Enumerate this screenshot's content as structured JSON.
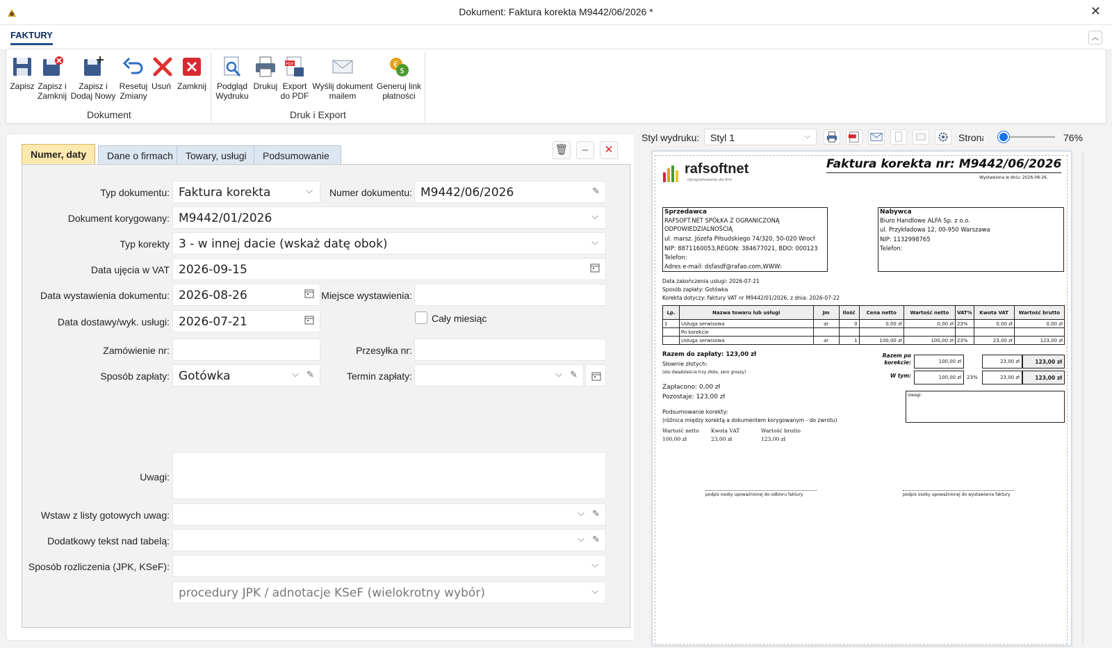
{
  "window": {
    "title": "Dokument: Faktura korekta M9442/06/2026 *"
  },
  "ribbon": {
    "tab": "FAKTURY",
    "buttons": [
      {
        "label": "Zapisz",
        "icon": "save-icon"
      },
      {
        "label": "Zapisz i Zamknij",
        "icon": "save-close-icon"
      },
      {
        "label": "Zapisz i Dodaj Nowy",
        "icon": "save-new-icon"
      },
      {
        "label": "Resetuj Zmiany",
        "icon": "undo-icon"
      },
      {
        "label": "Usuń",
        "icon": "delete-icon"
      },
      {
        "label": "Zamknij",
        "icon": "close-icon"
      },
      {
        "label": "Podgląd Wydruku",
        "icon": "print-preview-icon"
      },
      {
        "label": "Drukuj",
        "icon": "printer-icon"
      },
      {
        "label": "Export do PDF",
        "icon": "pdf-icon"
      },
      {
        "label": "Wyślij dokument mailem",
        "icon": "mail-icon"
      },
      {
        "label": "Generuj link płatności",
        "icon": "payment-link-icon"
      }
    ],
    "groups": {
      "dokument": "Dokument",
      "druk": "Druk i Export"
    }
  },
  "tabs": [
    "Numer, daty",
    "Dane o firmach",
    "Towary, usługi",
    "Podsumowanie"
  ],
  "form": {
    "typ_dokumentu": {
      "label": "Typ dokumentu:",
      "value": "Faktura korekta"
    },
    "numer_dokumentu": {
      "label": "Numer dokumentu:",
      "value": "M9442/06/2026"
    },
    "dokument_korygowany": {
      "label": "Dokument korygowany:",
      "value": "M9442/01/2026"
    },
    "typ_korekty": {
      "label": "Typ korekty",
      "value": "3 - w innej dacie (wskaż datę obok)"
    },
    "data_ujecia": {
      "label": "Data ujęcia w VAT",
      "value": "2026-09-15"
    },
    "data_wystawienia": {
      "label": "Data wystawienia dokumentu:",
      "value": "2026-08-26"
    },
    "miejsce_wystawienia": {
      "label": "Miejsce wystawienia:",
      "value": ""
    },
    "data_dostawy": {
      "label": "Data dostawy/wyk. usługi:",
      "value": "2026-07-21"
    },
    "caly_miesiac": {
      "label": "Cały miesiąc"
    },
    "zamowienie": {
      "label": "Zamówienie nr:",
      "value": ""
    },
    "przesylka": {
      "label": "Przesyłka nr:",
      "value": ""
    },
    "sposob_zaplaty": {
      "label": "Sposób zapłaty:",
      "value": "Gotówka"
    },
    "termin_zaplaty": {
      "label": "Termin zapłaty:",
      "value": ""
    },
    "uwagi": {
      "label": "Uwagi:",
      "value": ""
    },
    "gotowe_uwagi": {
      "label": "Wstaw z listy gotowych uwag:",
      "value": ""
    },
    "tekst_nad_tabela": {
      "label": "Dodatkowy tekst nad tabelą:",
      "value": ""
    },
    "sposob_rozliczenia": {
      "label": "Sposób rozliczenia (JPK, KSeF):",
      "value": ""
    },
    "procedury": {
      "placeholder": "procedury JPK / adnotacje KSeF (wielokrotny wybór)"
    }
  },
  "preview": {
    "style_label": "Styl wydruku:",
    "style_value": "Styl 1",
    "zoom_label": "Strona",
    "zoom_value": "76%",
    "zoom_fraction": 0.0,
    "doc": {
      "logo": "rafsoftnet",
      "logo_sub": "Oprogramowanie dla firm",
      "title": "Faktura korekta nr: M9442/06/2026",
      "issued": "Wystawiona w dniu: 2026-08-26,",
      "seller_h": "Sprzedawca",
      "seller": [
        "RAFSOFT.NET SPÓŁKA Z OGRANICZONĄ",
        "ODPOWIEDZIALNOŚCIĄ",
        "ul. marsz. Józefa Piłsudskiego 74/320, 50-020 Wrocł",
        "NIP: 8871160053,REGON: 384677021, BDO: 000123",
        "Telefon:",
        "Adres e-mail: dsfasdf@rafao.com,WWW:"
      ],
      "buyer_h": "Nabywca",
      "buyer": [
        "Biuro Handlowe ALFA Sp. z o.o.",
        "ul. Przykładowa 12, 00-950 Warszawa",
        "NIP: 1132998765",
        "Telefon:"
      ],
      "info": [
        "Data zakończenia usługi: 2026-07-21",
        "Sposób zapłaty: Gotówka",
        "Korekta dotyczy: faktury VAT nr M9442/01/2026, z dnia: 2026-07-22"
      ],
      "headers": [
        "Lp.",
        "Nazwa towaru lub usługi",
        "Jm",
        "Ilość",
        "Cena netto",
        "Wartość netto",
        "VAT%",
        "Kwota VAT",
        "Wartość brutto"
      ],
      "rows": [
        [
          "1",
          "Usługa serwisowa",
          "ar",
          "0",
          "0,00 zł",
          "0,00 zł",
          "23%",
          "0,00 zł",
          "0,00 zł"
        ],
        [
          "",
          "Po korekcie",
          "",
          "",
          "",
          "",
          "",
          "",
          ""
        ],
        [
          "",
          "Usługa serwisowa",
          "ar",
          "1",
          "100,00 zł",
          "100,00 zł",
          "23%",
          "23,00 zł",
          "123,00 zł"
        ]
      ],
      "razem": "Razem do zapłaty: 123,00 zł",
      "slownie": "Słownie złotych:",
      "slownie2": "(sto dwadzieścia trzy złote, zero groszy)",
      "razem_po_l1": "Razem po",
      "razem_po_l2": "korekcie:",
      "w_tym": "W tym:",
      "sum1": [
        "100,00 zł",
        "23,00 zł",
        "123,00 zł"
      ],
      "sum2": [
        "100,00 zł",
        "23%",
        "23,00 zł",
        "123,00 zł"
      ],
      "zaplacono": "Zapłacono: 0,00 zł",
      "pozostaje": "Pozostaje: 123,00 zł",
      "uwagi": "Uwagi:",
      "podsum": "Podsumowanie korekty:",
      "podsum2": "(różnica między korektą a dokumentem korygowanym - do zwrotu)",
      "diff_h": [
        "Wartość netto",
        "Kwota VAT",
        "Wartość brutto"
      ],
      "diff_v": [
        "100,00 zł",
        "23,00 zł",
        "123,00 zł"
      ],
      "sig1": "podpis osoby upoważnionej do odbioru faktury",
      "sig2": "podpis osoby upoważnionej do wystawienia faktury"
    }
  }
}
